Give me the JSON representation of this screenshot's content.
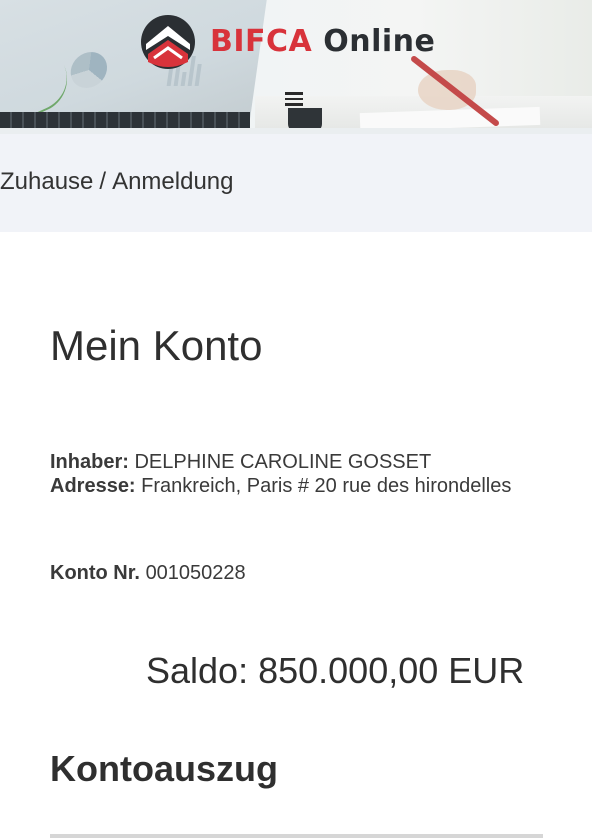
{
  "header": {
    "logo_text_primary": "BIFCA",
    "logo_text_secondary": "Online",
    "menu_icon": "hamburger-menu-icon",
    "colors": {
      "brand_red": "#d8333b",
      "brand_dark": "#2b2f33"
    }
  },
  "breadcrumb": {
    "items": [
      "Zuhause",
      "Anmeldung"
    ],
    "separator": "/"
  },
  "account": {
    "title": "Mein Konto",
    "holder_label": "Inhaber:",
    "holder_value": "DELPHINE CAROLINE GOSSET",
    "address_label": "Adresse:",
    "address_value": "Frankreich, Paris # 20 rue des hirondelles",
    "number_label": "Konto Nr.",
    "number_value": "001050228",
    "balance_text": "Saldo: 850.000,00 EUR"
  },
  "statement": {
    "title": "Kontoauszug"
  }
}
